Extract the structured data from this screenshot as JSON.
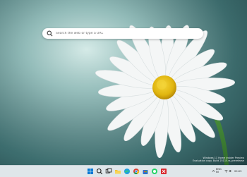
{
  "search": {
    "placeholder": "Search the web or type a URL",
    "icon": "search-icon"
  },
  "watermark": {
    "line1": "Windows 11 Home Insider Preview",
    "line2": "Evaluation copy. Build 25115.rs_prerelease"
  },
  "taskbar": {
    "icons": [
      "windows-start-icon",
      "search-icon",
      "task-view-icon",
      "file-explorer-icon",
      "edge-icon",
      "chrome-icon",
      "store-icon",
      "whatsapp-icon",
      "mail-icon",
      "news-icon"
    ],
    "tray": {
      "language": "ENG",
      "region": "IN",
      "time": "20:03"
    }
  },
  "colors": {
    "taskbar_bg": "#dfe6ea",
    "accent": "#0078d4",
    "daisy_center": "#e8c012"
  }
}
